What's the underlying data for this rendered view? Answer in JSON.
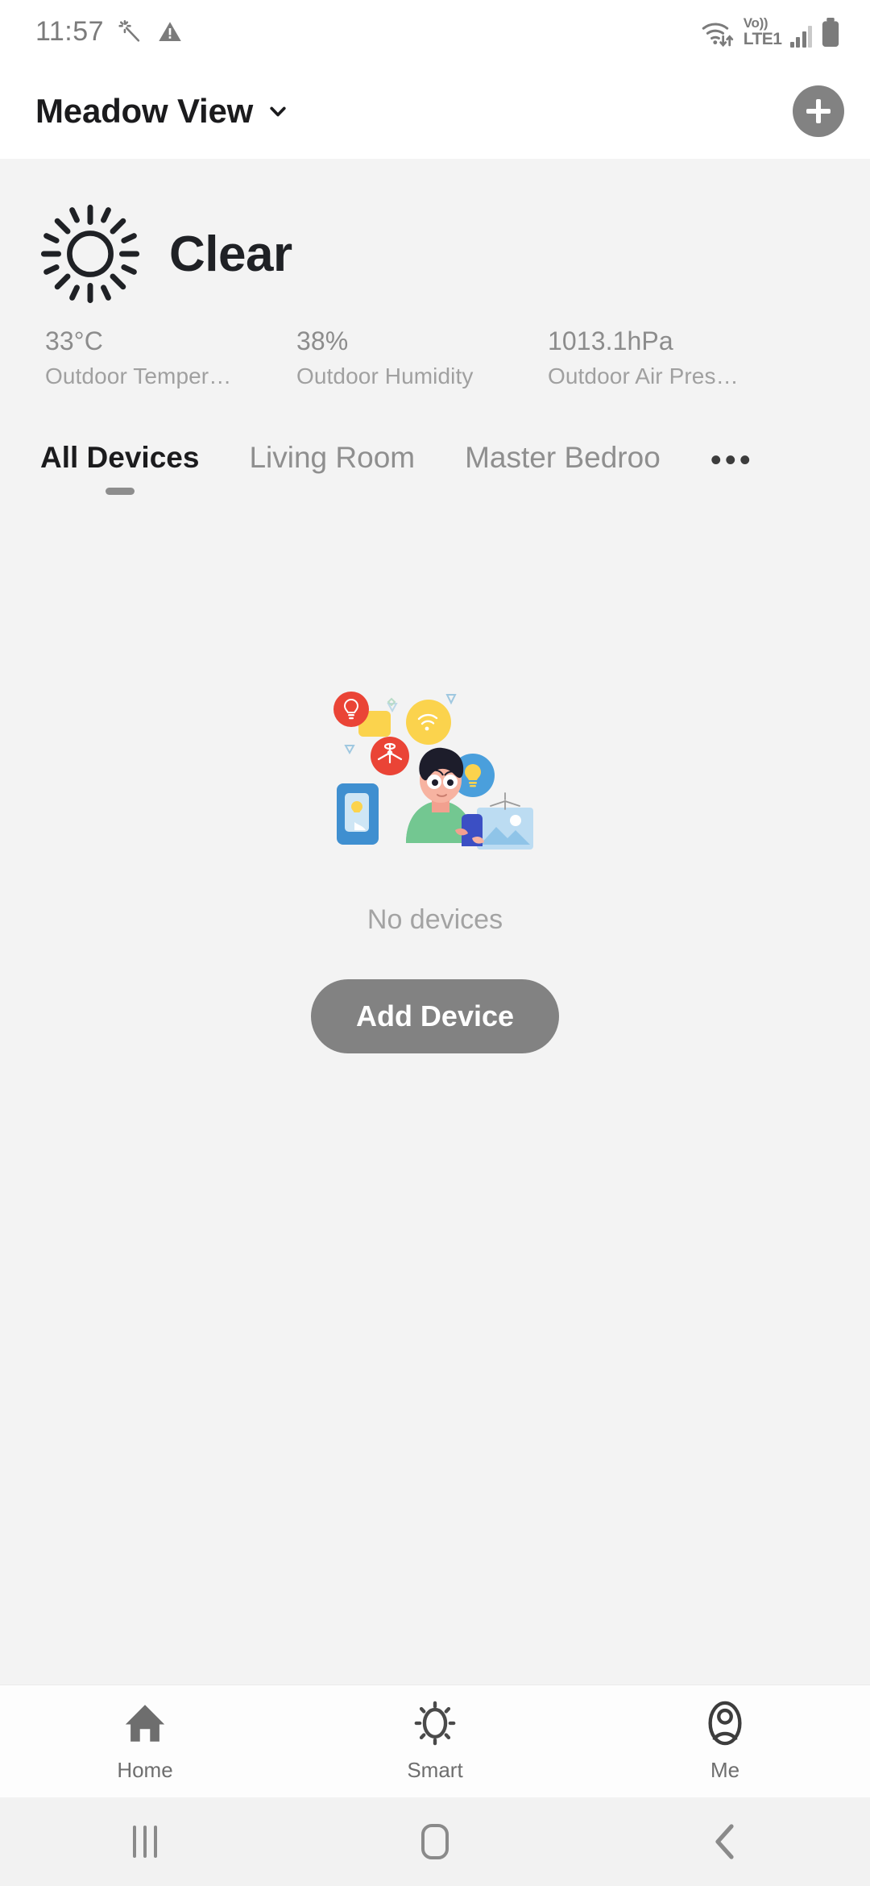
{
  "status_bar": {
    "time": "11:57",
    "left_icons": [
      "magic-wand-icon",
      "warning-triangle-icon"
    ],
    "network_label_top": "Vo))",
    "network_label_bottom": "LTE1",
    "right_icons": [
      "wifi-data-icon",
      "signal-bars-icon",
      "battery-icon"
    ]
  },
  "header": {
    "home_name": "Meadow View",
    "dropdown_icon": "chevron-down-icon",
    "add_icon": "plus-icon"
  },
  "weather": {
    "icon": "sun-icon",
    "condition": "Clear",
    "stats": [
      {
        "value": "33°C",
        "label": "Outdoor Temper…"
      },
      {
        "value": "38%",
        "label": "Outdoor Humidity"
      },
      {
        "value": "1013.1hPa",
        "label": "Outdoor Air Pres…"
      }
    ]
  },
  "tabs": {
    "items": [
      {
        "label": "All Devices",
        "active": true
      },
      {
        "label": "Living Room",
        "active": false
      },
      {
        "label": "Master Bedroo",
        "active": false
      }
    ],
    "overflow_label": "•••"
  },
  "empty_state": {
    "illustration": "smart-home-person-illustration",
    "message": "No devices",
    "action_label": "Add Device"
  },
  "bottom_nav": {
    "items": [
      {
        "label": "Home",
        "icon": "house-icon",
        "active": true
      },
      {
        "label": "Smart",
        "icon": "brightness-sun-icon",
        "active": false
      },
      {
        "label": "Me",
        "icon": "person-circle-icon",
        "active": false
      }
    ]
  },
  "system_nav": {
    "recents": "recents-icon",
    "home": "home-square-icon",
    "back": "back-chevron-icon"
  },
  "colors": {
    "accent_gray": "#828282",
    "page_bg": "#f3f3f3",
    "header_bg": "#ffffff",
    "text_primary": "#1b1b1d",
    "text_muted": "#a0a0a0"
  }
}
